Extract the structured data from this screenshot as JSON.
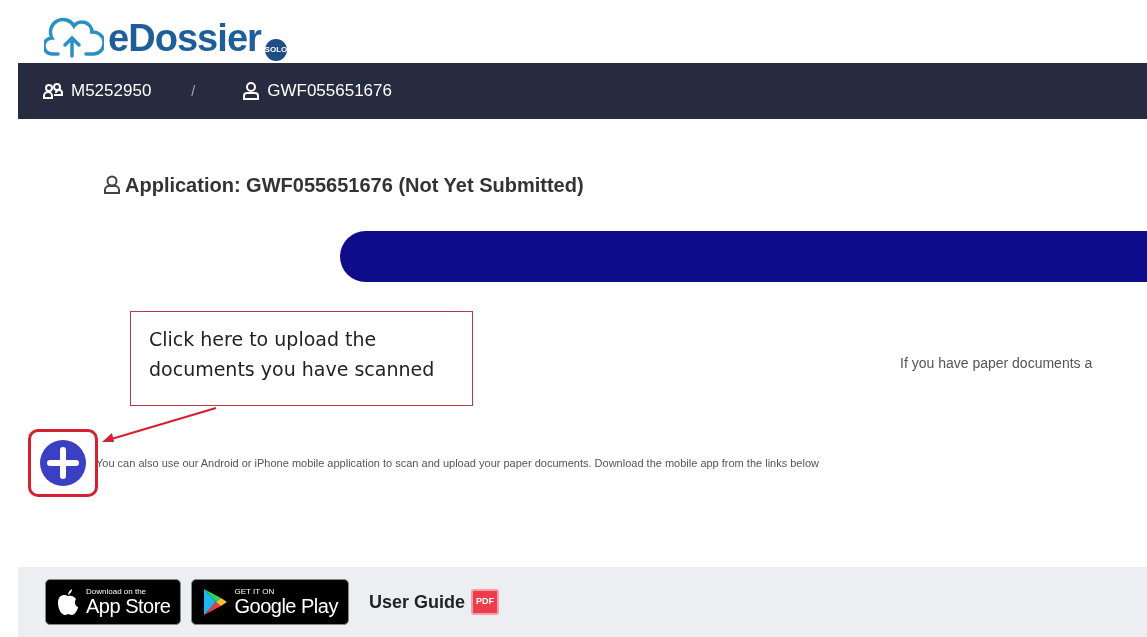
{
  "logo": {
    "text": "eDossier",
    "badge": "SOLO"
  },
  "breadcrumb": [
    {
      "kind": "group",
      "label": "M5252950"
    },
    {
      "kind": "separator",
      "label": "/"
    },
    {
      "kind": "person",
      "label": "GWF055651676"
    }
  ],
  "application_title": "Application: GWF055651676 (Not Yet Submitted)",
  "callout": {
    "text": "Click here to upload the documents you have scanned"
  },
  "paper_note": "If you have paper documents a",
  "mobile_note": "You can also use our Android or iPhone mobile application to scan and upload your paper documents. Download the mobile app from the links below",
  "footer": {
    "stores": [
      {
        "kind": "apple",
        "small": "Download on the",
        "big": "App Store"
      },
      {
        "kind": "google",
        "small": "GET IT ON",
        "big": "Google Play"
      }
    ],
    "user_guide": "User Guide",
    "pdf_badge": "PDF"
  }
}
